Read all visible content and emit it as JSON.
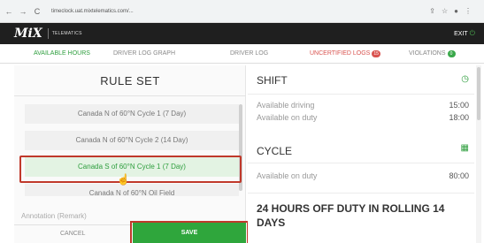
{
  "browser": {
    "url": "timeclock.uat.mixtelematics.com/..."
  },
  "app": {
    "logo": "MiX",
    "brand": "TELEMATICS",
    "exit_label": "EXIT"
  },
  "tabs": [
    {
      "label": "AVAILABLE HOURS"
    },
    {
      "label": "DRIVER LOG GRAPH"
    },
    {
      "label": "DRIVER LOG"
    },
    {
      "label": "UNCERTIFIED LOGS",
      "badge": "15"
    },
    {
      "label": "VIOLATIONS",
      "badge": "0"
    }
  ],
  "ruleset": {
    "title": "RULE SET",
    "items": [
      {
        "label": "Canada N of 60°N Cycle 1 (7 Day)"
      },
      {
        "label": "Canada N of 60°N Cycle 2 (14 Day)"
      },
      {
        "label": "Canada S of 60°N Cycle 1 (7 Day)"
      },
      {
        "label": "Canada N of 60°N Oil Field"
      }
    ],
    "annotation_placeholder": "Annotation (Remark)",
    "cancel_label": "CANCEL",
    "save_label": "SAVE"
  },
  "shift": {
    "title": "SHIFT",
    "available_driving_label": "Available driving",
    "available_driving_value": "15:00",
    "available_on_duty_label": "Available on duty",
    "available_on_duty_value": "18:00"
  },
  "cycle": {
    "title": "CYCLE",
    "available_on_duty_label": "Available on duty",
    "available_on_duty_value": "80:00"
  },
  "rolling": {
    "title": "24 HOURS OFF DUTY IN ROLLING 14 DAYS"
  },
  "colors": {
    "accent_green": "#2fa63c",
    "highlight_red": "#c0392b",
    "header_dark": "#1f1f1f"
  }
}
